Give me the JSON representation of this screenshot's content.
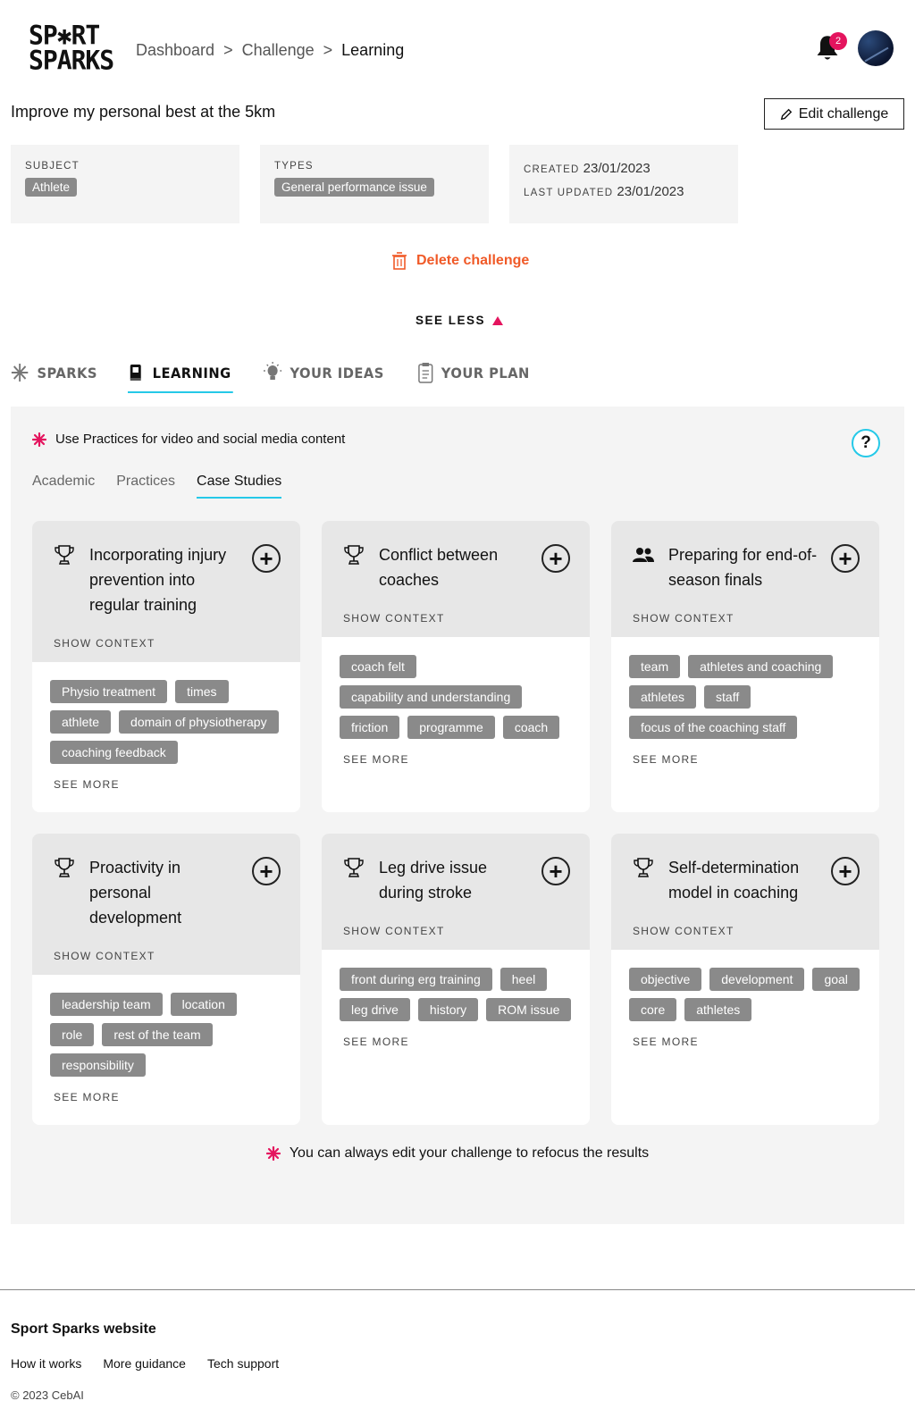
{
  "logo": {
    "line1": "SP✱RT",
    "line2": "SPARKS"
  },
  "breadcrumb": {
    "item1": "Dashboard",
    "sep1": ">",
    "item2": "Challenge",
    "sep2": ">",
    "current": "Learning"
  },
  "notifications": {
    "count": "2",
    "icon": "bell-icon"
  },
  "challenge": {
    "title": "Improve my personal best at the 5km",
    "edit_label": "Edit challenge",
    "subject_label": "SUBJECT",
    "subject_value": "Athlete",
    "types_label": "TYPES",
    "types_value": "General performance issue",
    "created_label": "CREATED",
    "created_value": "23/01/2023",
    "updated_label": "LAST UPDATED",
    "updated_value": "23/01/2023",
    "delete_label": "Delete challenge",
    "see_less_label": "SEE LESS"
  },
  "main_tabs": [
    {
      "label": "SPARKS",
      "icon": "asterisk-icon"
    },
    {
      "label": "LEARNING",
      "icon": "book-icon"
    },
    {
      "label": "YOUR IDEAS",
      "icon": "lightbulb-icon"
    },
    {
      "label": "YOUR PLAN",
      "icon": "clipboard-icon"
    }
  ],
  "panel": {
    "tip": "Use Practices for video and social media content",
    "help": "?",
    "sub_tabs": [
      "Academic",
      "Practices",
      "Case Studies"
    ],
    "bottom_tip": "You can always edit your challenge to refocus the results",
    "show_context": "SHOW CONTEXT",
    "see_more": "SEE MORE"
  },
  "cards": [
    {
      "icon": "trophy-icon",
      "title": "Incorporating injury prevention into regular training",
      "tags": [
        "Physio treatment",
        "times",
        "athlete",
        "domain of physiotherapy",
        "coaching feedback"
      ]
    },
    {
      "icon": "trophy-icon",
      "title": "Conflict between coaches",
      "tags": [
        "coach felt",
        "capability and understanding",
        "friction",
        "programme",
        "coach"
      ]
    },
    {
      "icon": "people-icon",
      "title": "Preparing for end-of-season finals",
      "tags": [
        "team",
        "athletes and coaching",
        "athletes",
        "staff",
        "focus of the coaching staff"
      ]
    },
    {
      "icon": "trophy-icon",
      "title": "Proactivity in personal development",
      "tags": [
        "leadership team",
        "location",
        "role",
        "rest of the team",
        "responsibility"
      ]
    },
    {
      "icon": "trophy-icon",
      "title": "Leg drive issue during stroke",
      "tags": [
        "front during erg training",
        "heel",
        "leg drive",
        "history",
        "ROM issue"
      ]
    },
    {
      "icon": "trophy-icon",
      "title": "Self-determination model in coaching",
      "tags": [
        "objective",
        "development",
        "goal",
        "core",
        "athletes"
      ]
    }
  ],
  "footer": {
    "title": "Sport Sparks website",
    "links": [
      "How it works",
      "More guidance",
      "Tech support"
    ],
    "copyright": "© 2023 CebAI"
  },
  "colors": {
    "accent": "#25c9e8",
    "brand_pink": "#e4145e",
    "delete_orange": "#f05a28",
    "tag_grey": "#8a8a8a"
  }
}
